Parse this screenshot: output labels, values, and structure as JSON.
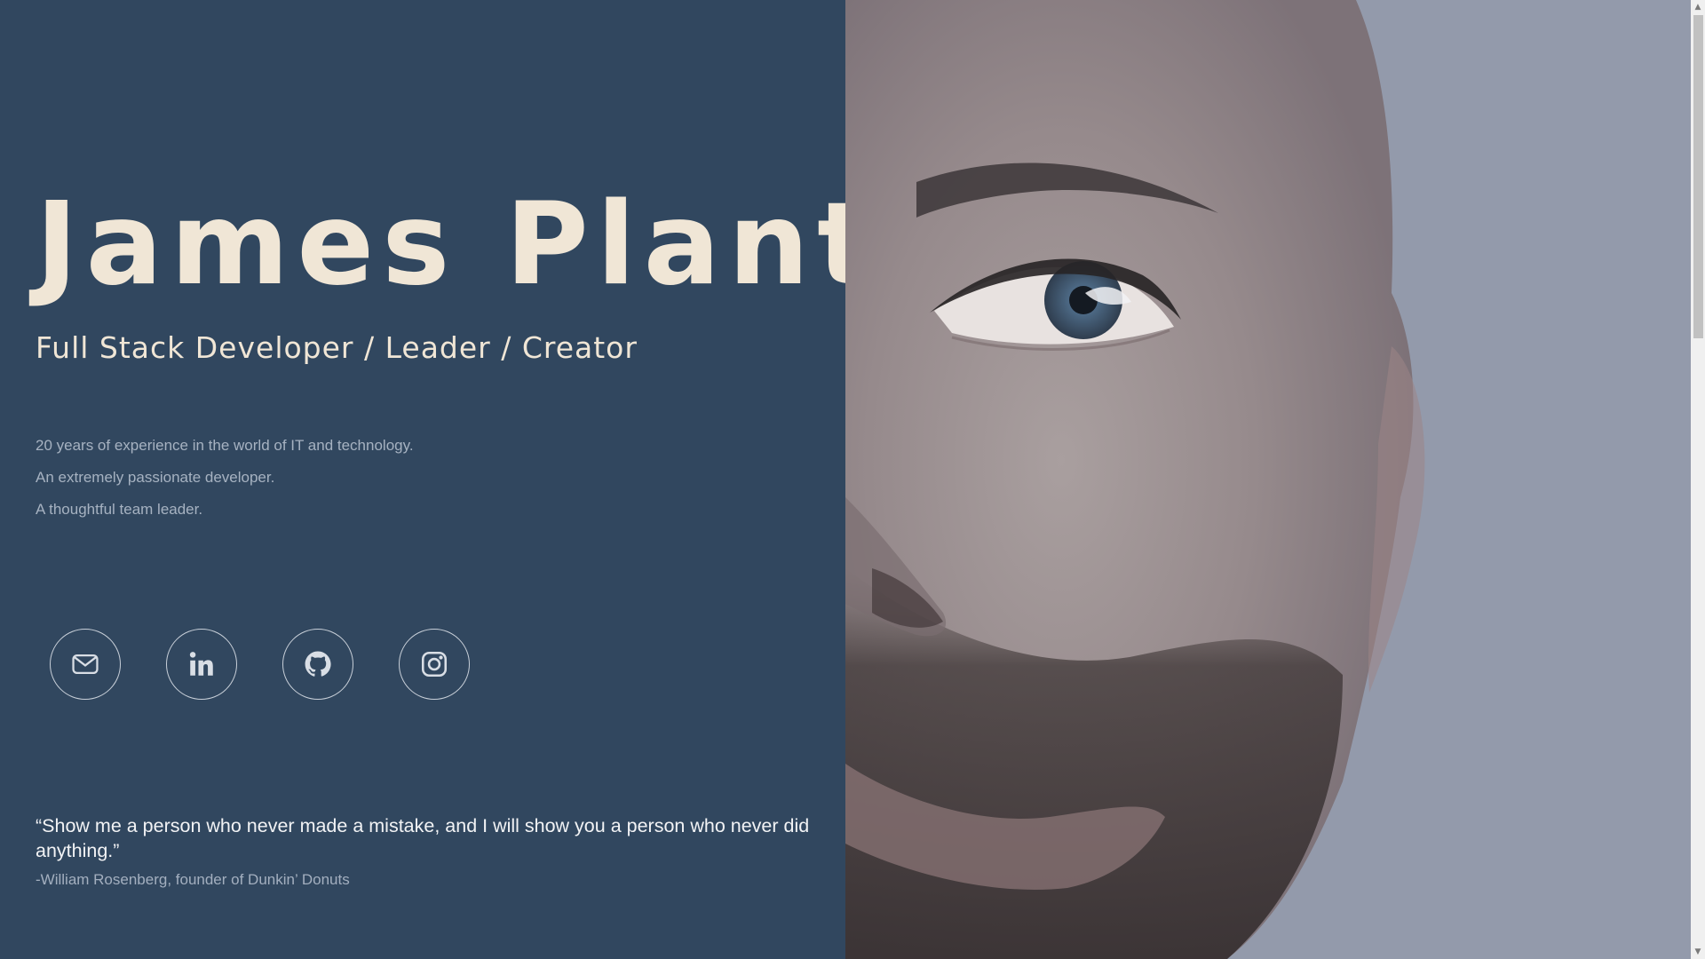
{
  "hero": {
    "name": "James Plant",
    "tagline": "Full Stack Developer / Leader / Creator",
    "bio": [
      "20 years of experience in the world of IT and technology.",
      "An extremely passionate developer.",
      "A thoughtful team leader."
    ]
  },
  "socials": [
    {
      "icon": "envelope-icon",
      "label": "Email"
    },
    {
      "icon": "linkedin-icon",
      "label": "LinkedIn"
    },
    {
      "icon": "github-icon",
      "label": "GitHub"
    },
    {
      "icon": "instagram-icon",
      "label": "Instagram"
    }
  ],
  "quote": {
    "text": "“Show me a person who never made a mistake, and I will show you a person who never did anything.”",
    "attribution": "-William Rosenberg, founder of Dunkin’ Donuts"
  },
  "photo": {
    "subject": "portrait-photo"
  },
  "colors": {
    "panel_background": "#31475f",
    "name_color": "#f0e6d6",
    "bio_text": "#a6b2c1",
    "icon_stroke": "#c9d0d9"
  },
  "scrollbar": {
    "up_arrow": "▲",
    "down_arrow": "▼"
  }
}
